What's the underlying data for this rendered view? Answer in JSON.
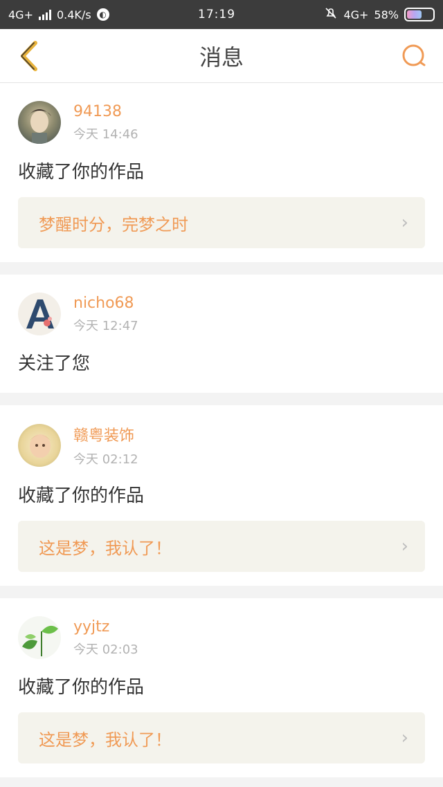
{
  "status_bar": {
    "network_left": "4G+",
    "speed": "0.4K/s",
    "time": "17:19",
    "network_right": "4G+",
    "battery_percent": "58%",
    "battery_level": 0.58
  },
  "header": {
    "title": "消息",
    "back_icon": "chevron-left-icon",
    "search_icon": "search-icon",
    "accent_color": "#f09a55"
  },
  "notifications": [
    {
      "username": "94138",
      "time": "今天 14:46",
      "action": "收藏了你的作品",
      "work_title": "梦醒时分，完梦之时",
      "avatar": "boy-portrait"
    },
    {
      "username": "nicho68",
      "time": "今天 12:47",
      "action": "关注了您",
      "work_title": null,
      "avatar": "letter-a"
    },
    {
      "username": "赣粤装饰",
      "time": "今天 02:12",
      "action": "收藏了你的作品",
      "work_title": "这是梦，我认了！",
      "avatar": "baby-portrait"
    },
    {
      "username": "yyjtz",
      "time": "今天 02:03",
      "action": "收藏了你的作品",
      "work_title": "这是梦，我认了！",
      "avatar": "sprout"
    }
  ]
}
